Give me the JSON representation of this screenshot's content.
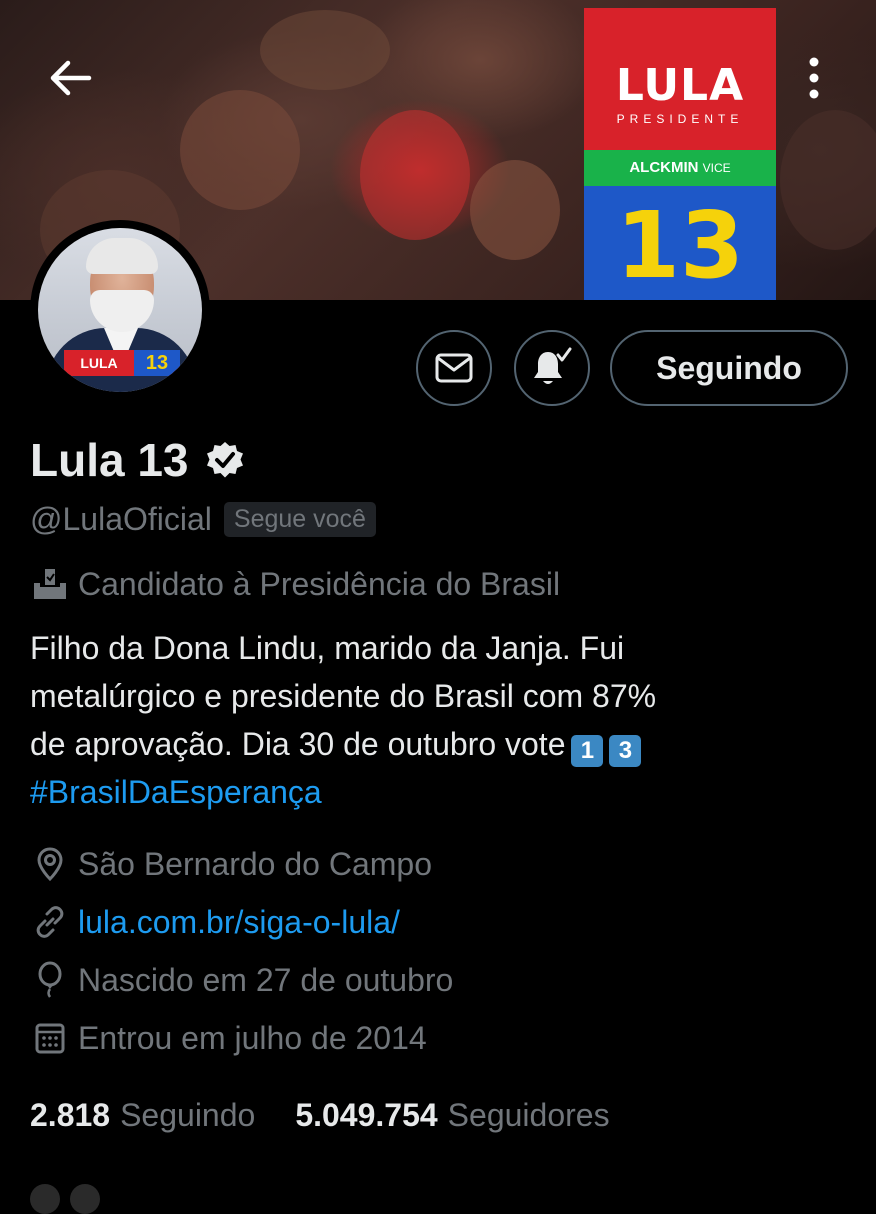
{
  "banner": {
    "logo_title": "LULA",
    "logo_subtitle": "PRESIDENTE",
    "logo_vice_name": "ALCKMIN",
    "logo_vice_word": "VICE",
    "logo_number": "13"
  },
  "avatar": {
    "badge_name": "LULA",
    "badge_number": "13"
  },
  "actions": {
    "following_label": "Seguindo"
  },
  "profile": {
    "name": "Lula 13",
    "handle": "@LulaOficial",
    "follows_you": "Segue você",
    "category": "Candidato à Presidência do Brasil",
    "bio": {
      "line1": "Filho da Dona Lindu, marido da Janja. Fui",
      "line2": "metalúrgico e presidente do Brasil com 87%",
      "line3": "de aprovação. Dia 30 de outubro vote",
      "keycap1": "1",
      "keycap2": "3",
      "hashtag": "#BrasilDaEsperança"
    },
    "location": "São Bernardo do Campo",
    "website": "lula.com.br/siga-o-lula/",
    "birth": "Nascido em 27 de outubro",
    "joined": "Entrou em julho de 2014"
  },
  "stats": {
    "following_count": "2.818",
    "following_label": "Seguindo",
    "followers_count": "5.049.754",
    "followers_label": "Seguidores"
  },
  "colors": {
    "background": "#000000",
    "text_primary": "#e7e9ea",
    "text_secondary": "#71767b",
    "link": "#1d9bf0",
    "border": "#536471"
  }
}
